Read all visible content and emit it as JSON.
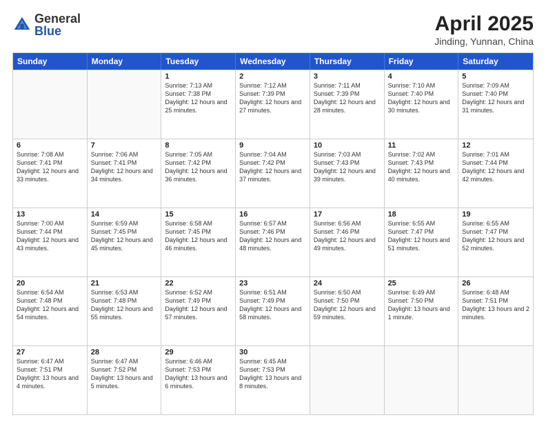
{
  "logo": {
    "general": "General",
    "blue": "Blue"
  },
  "title": "April 2025",
  "subtitle": "Jinding, Yunnan, China",
  "headers": [
    "Sunday",
    "Monday",
    "Tuesday",
    "Wednesday",
    "Thursday",
    "Friday",
    "Saturday"
  ],
  "rows": [
    [
      {
        "day": "",
        "info": "",
        "empty": true
      },
      {
        "day": "",
        "info": "",
        "empty": true
      },
      {
        "day": "1",
        "info": "Sunrise: 7:13 AM\nSunset: 7:38 PM\nDaylight: 12 hours and 25 minutes."
      },
      {
        "day": "2",
        "info": "Sunrise: 7:12 AM\nSunset: 7:39 PM\nDaylight: 12 hours and 27 minutes."
      },
      {
        "day": "3",
        "info": "Sunrise: 7:11 AM\nSunset: 7:39 PM\nDaylight: 12 hours and 28 minutes."
      },
      {
        "day": "4",
        "info": "Sunrise: 7:10 AM\nSunset: 7:40 PM\nDaylight: 12 hours and 30 minutes."
      },
      {
        "day": "5",
        "info": "Sunrise: 7:09 AM\nSunset: 7:40 PM\nDaylight: 12 hours and 31 minutes."
      }
    ],
    [
      {
        "day": "6",
        "info": "Sunrise: 7:08 AM\nSunset: 7:41 PM\nDaylight: 12 hours and 33 minutes."
      },
      {
        "day": "7",
        "info": "Sunrise: 7:06 AM\nSunset: 7:41 PM\nDaylight: 12 hours and 34 minutes."
      },
      {
        "day": "8",
        "info": "Sunrise: 7:05 AM\nSunset: 7:42 PM\nDaylight: 12 hours and 36 minutes."
      },
      {
        "day": "9",
        "info": "Sunrise: 7:04 AM\nSunset: 7:42 PM\nDaylight: 12 hours and 37 minutes."
      },
      {
        "day": "10",
        "info": "Sunrise: 7:03 AM\nSunset: 7:43 PM\nDaylight: 12 hours and 39 minutes."
      },
      {
        "day": "11",
        "info": "Sunrise: 7:02 AM\nSunset: 7:43 PM\nDaylight: 12 hours and 40 minutes."
      },
      {
        "day": "12",
        "info": "Sunrise: 7:01 AM\nSunset: 7:44 PM\nDaylight: 12 hours and 42 minutes."
      }
    ],
    [
      {
        "day": "13",
        "info": "Sunrise: 7:00 AM\nSunset: 7:44 PM\nDaylight: 12 hours and 43 minutes."
      },
      {
        "day": "14",
        "info": "Sunrise: 6:59 AM\nSunset: 7:45 PM\nDaylight: 12 hours and 45 minutes."
      },
      {
        "day": "15",
        "info": "Sunrise: 6:58 AM\nSunset: 7:45 PM\nDaylight: 12 hours and 46 minutes."
      },
      {
        "day": "16",
        "info": "Sunrise: 6:57 AM\nSunset: 7:46 PM\nDaylight: 12 hours and 48 minutes."
      },
      {
        "day": "17",
        "info": "Sunrise: 6:56 AM\nSunset: 7:46 PM\nDaylight: 12 hours and 49 minutes."
      },
      {
        "day": "18",
        "info": "Sunrise: 6:55 AM\nSunset: 7:47 PM\nDaylight: 12 hours and 51 minutes."
      },
      {
        "day": "19",
        "info": "Sunrise: 6:55 AM\nSunset: 7:47 PM\nDaylight: 12 hours and 52 minutes."
      }
    ],
    [
      {
        "day": "20",
        "info": "Sunrise: 6:54 AM\nSunset: 7:48 PM\nDaylight: 12 hours and 54 minutes."
      },
      {
        "day": "21",
        "info": "Sunrise: 6:53 AM\nSunset: 7:48 PM\nDaylight: 12 hours and 55 minutes."
      },
      {
        "day": "22",
        "info": "Sunrise: 6:52 AM\nSunset: 7:49 PM\nDaylight: 12 hours and 57 minutes."
      },
      {
        "day": "23",
        "info": "Sunrise: 6:51 AM\nSunset: 7:49 PM\nDaylight: 12 hours and 58 minutes."
      },
      {
        "day": "24",
        "info": "Sunrise: 6:50 AM\nSunset: 7:50 PM\nDaylight: 12 hours and 59 minutes."
      },
      {
        "day": "25",
        "info": "Sunrise: 6:49 AM\nSunset: 7:50 PM\nDaylight: 13 hours and 1 minute."
      },
      {
        "day": "26",
        "info": "Sunrise: 6:48 AM\nSunset: 7:51 PM\nDaylight: 13 hours and 2 minutes."
      }
    ],
    [
      {
        "day": "27",
        "info": "Sunrise: 6:47 AM\nSunset: 7:51 PM\nDaylight: 13 hours and 4 minutes."
      },
      {
        "day": "28",
        "info": "Sunrise: 6:47 AM\nSunset: 7:52 PM\nDaylight: 13 hours and 5 minutes."
      },
      {
        "day": "29",
        "info": "Sunrise: 6:46 AM\nSunset: 7:53 PM\nDaylight: 13 hours and 6 minutes."
      },
      {
        "day": "30",
        "info": "Sunrise: 6:45 AM\nSunset: 7:53 PM\nDaylight: 13 hours and 8 minutes."
      },
      {
        "day": "",
        "info": "",
        "empty": true
      },
      {
        "day": "",
        "info": "",
        "empty": true
      },
      {
        "day": "",
        "info": "",
        "empty": true
      }
    ]
  ]
}
